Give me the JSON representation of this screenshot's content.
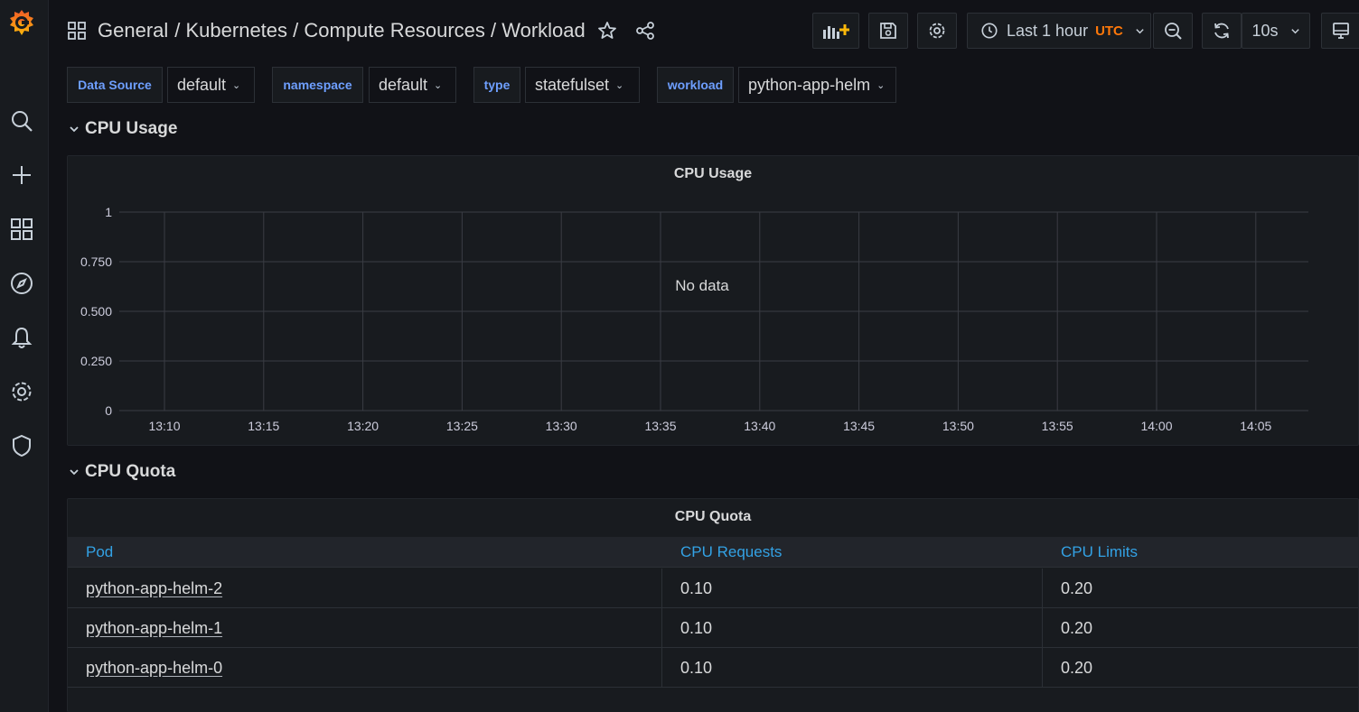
{
  "breadcrumb": {
    "folder": "General",
    "path": [
      "/ Kubernetes / Compute Resources / Workload"
    ]
  },
  "toolbar": {
    "time_range": "Last 1 hour",
    "timezone": "UTC",
    "refresh_interval": "10s"
  },
  "variables": [
    {
      "label": "Data Source",
      "value": "default"
    },
    {
      "label": "namespace",
      "value": "default"
    },
    {
      "label": "type",
      "value": "statefulset"
    },
    {
      "label": "workload",
      "value": "python-app-helm"
    }
  ],
  "rows": {
    "cpu_usage": "CPU Usage",
    "cpu_quota": "CPU Quota"
  },
  "panels": {
    "cpu_usage": {
      "title": "CPU Usage",
      "no_data": "No data"
    },
    "cpu_quota": {
      "title": "CPU Quota",
      "columns": [
        "Pod",
        "CPU Requests",
        "CPU Limits"
      ],
      "rows": [
        {
          "pod": "python-app-helm-2",
          "requests": "0.10",
          "limits": "0.20"
        },
        {
          "pod": "python-app-helm-1",
          "requests": "0.10",
          "limits": "0.20"
        },
        {
          "pod": "python-app-helm-0",
          "requests": "0.10",
          "limits": "0.20"
        }
      ]
    }
  },
  "chart_data": {
    "type": "line",
    "title": "CPU Usage",
    "x": [
      "13:10",
      "13:15",
      "13:20",
      "13:25",
      "13:30",
      "13:35",
      "13:40",
      "13:45",
      "13:50",
      "13:55",
      "14:00",
      "14:05"
    ],
    "y_ticks": [
      "0",
      "0.250",
      "0.500",
      "0.750",
      "1"
    ],
    "ylim": [
      0,
      1
    ],
    "series": [],
    "grid": true,
    "annotation": "No data"
  },
  "colors": {
    "accent": "#6e9fff",
    "link": "#33a2e5",
    "timezone": "#ff780a",
    "logo": "#f46800"
  }
}
